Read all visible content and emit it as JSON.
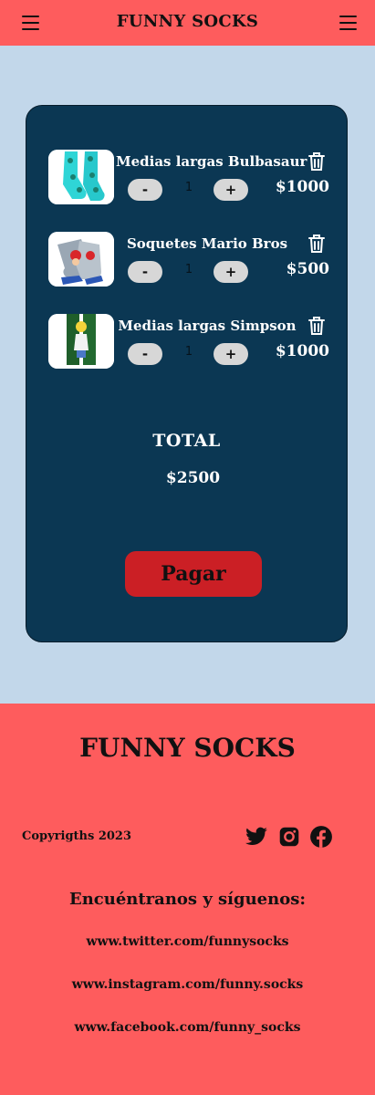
{
  "header": {
    "brand": "FUNNY SOCKS",
    "left_icon": "hamburger-menu-icon",
    "right_icon": "hamburger-menu-icon"
  },
  "cart": {
    "items": [
      {
        "name": "Medias largas Bulbasaur",
        "quantity": "1",
        "price": "$1000",
        "minus_label": "-",
        "plus_label": "+",
        "image_icon": "bulbasaur-sock-image"
      },
      {
        "name": "Soquetes Mario Bros",
        "quantity": "1",
        "price": "$500",
        "minus_label": "-",
        "plus_label": "+",
        "image_icon": "mario-sock-image"
      },
      {
        "name": "Medias largas Simpson",
        "quantity": "1",
        "price": "$1000",
        "minus_label": "-",
        "plus_label": "+",
        "image_icon": "simpson-sock-image"
      }
    ],
    "total_label": "TOTAL",
    "total_value": "$2500",
    "pay_label": "Pagar"
  },
  "footer": {
    "brand": "FUNNY SOCKS",
    "copyright": "Copyrigths 2023",
    "follow_title": "Encuéntranos y síguenos:",
    "links": [
      "www.twitter.com/funnysocks",
      "www.instagram.com/funny.socks",
      "www.facebook.com/funny_socks"
    ],
    "social_icons": [
      "twitter-icon",
      "instagram-icon",
      "facebook-icon"
    ]
  },
  "colors": {
    "header_bg": "#fe5c5d",
    "page_bg": "#c2d7ea",
    "cart_bg": "#0b3753",
    "pay_button": "#cb1f25",
    "qty_button": "#d7d7d7"
  }
}
